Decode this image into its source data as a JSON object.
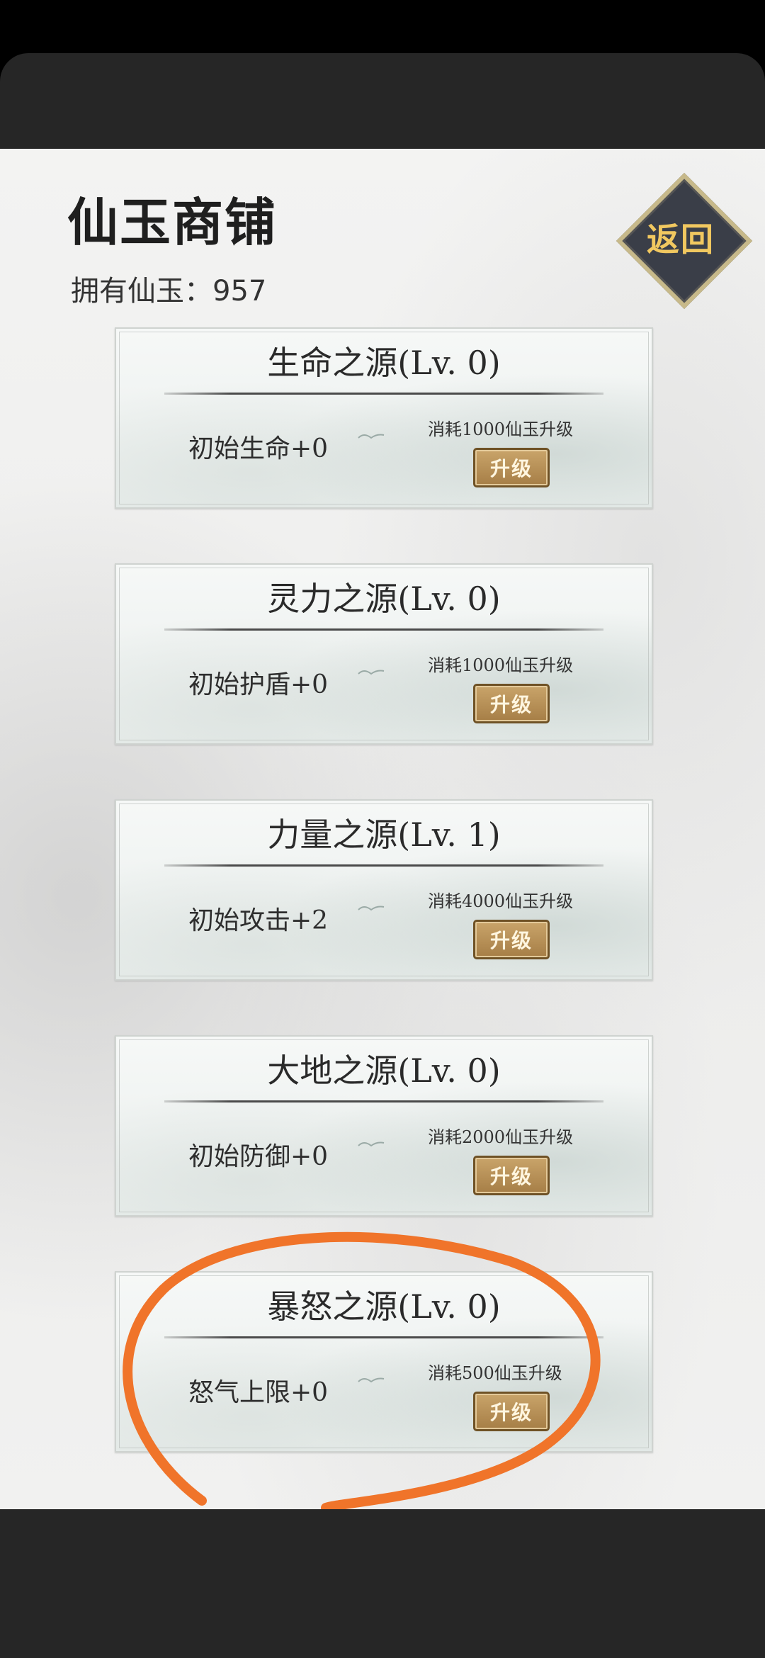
{
  "shop": {
    "title": "仙玉商铺",
    "jade_label": "拥有仙玉：957",
    "back_label": "返回",
    "upgrade_label": "升级"
  },
  "cards": [
    {
      "title": "生命之源(Lv. 0)",
      "effect": "初始生命+0",
      "cost": "消耗1000仙玉升级"
    },
    {
      "title": "灵力之源(Lv. 0)",
      "effect": "初始护盾+0",
      "cost": "消耗1000仙玉升级"
    },
    {
      "title": "力量之源(Lv. 1)",
      "effect": "初始攻击+2",
      "cost": "消耗4000仙玉升级"
    },
    {
      "title": "大地之源(Lv. 0)",
      "effect": "初始防御+0",
      "cost": "消耗2000仙玉升级"
    },
    {
      "title": "暴怒之源(Lv. 0)",
      "effect": "怒气上限+0",
      "cost": "消耗500仙玉升级"
    }
  ],
  "colors": {
    "bars": "#262626",
    "upgrade_button": "#b08a52",
    "back_button_fill": "#3a3e48",
    "back_button_text": "#f1c860",
    "annotation": "#f0742a"
  },
  "icons": [
    "bird-icon"
  ]
}
